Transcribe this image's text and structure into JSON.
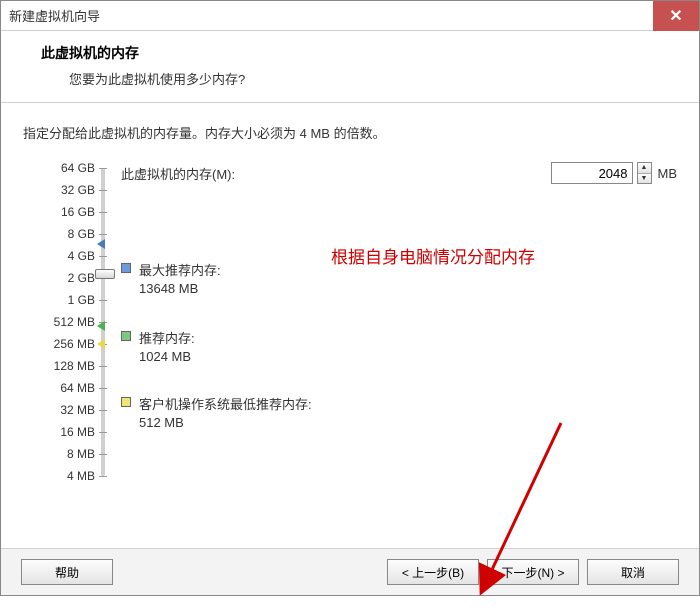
{
  "window": {
    "title": "新建虚拟机向导",
    "close_glyph": "✕"
  },
  "header": {
    "title": "此虚拟机的内存",
    "subtitle": "您要为此虚拟机使用多少内存?"
  },
  "instruction": "指定分配给此虚拟机的内存量。内存大小必须为 4 MB 的倍数。",
  "memory": {
    "label": "此虚拟机的内存(M):",
    "value": "2048",
    "unit": "MB"
  },
  "scale_labels": [
    "64 GB",
    "32 GB",
    "16 GB",
    "8 GB",
    "4 GB",
    "2 GB",
    "1 GB",
    "512 MB",
    "256 MB",
    "128 MB",
    "64 MB",
    "32 MB",
    "16 MB",
    "8 MB",
    "4 MB"
  ],
  "markers": {
    "max": {
      "label": "最大推荐内存:",
      "value": "13648 MB"
    },
    "rec": {
      "label": "推荐内存:",
      "value": "1024 MB"
    },
    "min": {
      "label": "客户机操作系统最低推荐内存:",
      "value": "512 MB"
    }
  },
  "annotation": "根据自身电脑情况分配内存",
  "footer": {
    "help": "帮助",
    "back": "< 上一步(B)",
    "next": "下一步(N) >",
    "cancel": "取消"
  }
}
